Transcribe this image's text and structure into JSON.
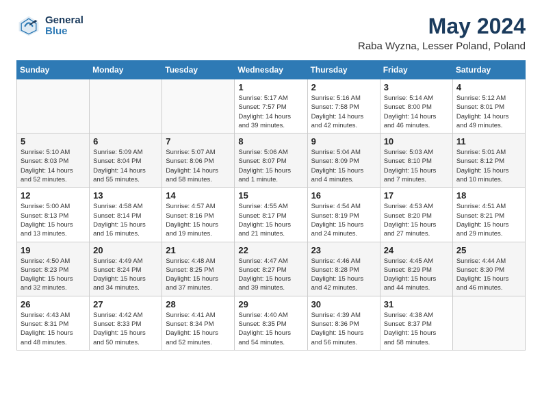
{
  "logo": {
    "general": "General",
    "blue": "Blue"
  },
  "title": "May 2024",
  "location": "Raba Wyzna, Lesser Poland, Poland",
  "weekdays": [
    "Sunday",
    "Monday",
    "Tuesday",
    "Wednesday",
    "Thursday",
    "Friday",
    "Saturday"
  ],
  "weeks": [
    [
      {
        "num": "",
        "info": ""
      },
      {
        "num": "",
        "info": ""
      },
      {
        "num": "",
        "info": ""
      },
      {
        "num": "1",
        "info": "Sunrise: 5:17 AM\nSunset: 7:57 PM\nDaylight: 14 hours\nand 39 minutes."
      },
      {
        "num": "2",
        "info": "Sunrise: 5:16 AM\nSunset: 7:58 PM\nDaylight: 14 hours\nand 42 minutes."
      },
      {
        "num": "3",
        "info": "Sunrise: 5:14 AM\nSunset: 8:00 PM\nDaylight: 14 hours\nand 46 minutes."
      },
      {
        "num": "4",
        "info": "Sunrise: 5:12 AM\nSunset: 8:01 PM\nDaylight: 14 hours\nand 49 minutes."
      }
    ],
    [
      {
        "num": "5",
        "info": "Sunrise: 5:10 AM\nSunset: 8:03 PM\nDaylight: 14 hours\nand 52 minutes."
      },
      {
        "num": "6",
        "info": "Sunrise: 5:09 AM\nSunset: 8:04 PM\nDaylight: 14 hours\nand 55 minutes."
      },
      {
        "num": "7",
        "info": "Sunrise: 5:07 AM\nSunset: 8:06 PM\nDaylight: 14 hours\nand 58 minutes."
      },
      {
        "num": "8",
        "info": "Sunrise: 5:06 AM\nSunset: 8:07 PM\nDaylight: 15 hours\nand 1 minute."
      },
      {
        "num": "9",
        "info": "Sunrise: 5:04 AM\nSunset: 8:09 PM\nDaylight: 15 hours\nand 4 minutes."
      },
      {
        "num": "10",
        "info": "Sunrise: 5:03 AM\nSunset: 8:10 PM\nDaylight: 15 hours\nand 7 minutes."
      },
      {
        "num": "11",
        "info": "Sunrise: 5:01 AM\nSunset: 8:12 PM\nDaylight: 15 hours\nand 10 minutes."
      }
    ],
    [
      {
        "num": "12",
        "info": "Sunrise: 5:00 AM\nSunset: 8:13 PM\nDaylight: 15 hours\nand 13 minutes."
      },
      {
        "num": "13",
        "info": "Sunrise: 4:58 AM\nSunset: 8:14 PM\nDaylight: 15 hours\nand 16 minutes."
      },
      {
        "num": "14",
        "info": "Sunrise: 4:57 AM\nSunset: 8:16 PM\nDaylight: 15 hours\nand 19 minutes."
      },
      {
        "num": "15",
        "info": "Sunrise: 4:55 AM\nSunset: 8:17 PM\nDaylight: 15 hours\nand 21 minutes."
      },
      {
        "num": "16",
        "info": "Sunrise: 4:54 AM\nSunset: 8:19 PM\nDaylight: 15 hours\nand 24 minutes."
      },
      {
        "num": "17",
        "info": "Sunrise: 4:53 AM\nSunset: 8:20 PM\nDaylight: 15 hours\nand 27 minutes."
      },
      {
        "num": "18",
        "info": "Sunrise: 4:51 AM\nSunset: 8:21 PM\nDaylight: 15 hours\nand 29 minutes."
      }
    ],
    [
      {
        "num": "19",
        "info": "Sunrise: 4:50 AM\nSunset: 8:23 PM\nDaylight: 15 hours\nand 32 minutes."
      },
      {
        "num": "20",
        "info": "Sunrise: 4:49 AM\nSunset: 8:24 PM\nDaylight: 15 hours\nand 34 minutes."
      },
      {
        "num": "21",
        "info": "Sunrise: 4:48 AM\nSunset: 8:25 PM\nDaylight: 15 hours\nand 37 minutes."
      },
      {
        "num": "22",
        "info": "Sunrise: 4:47 AM\nSunset: 8:27 PM\nDaylight: 15 hours\nand 39 minutes."
      },
      {
        "num": "23",
        "info": "Sunrise: 4:46 AM\nSunset: 8:28 PM\nDaylight: 15 hours\nand 42 minutes."
      },
      {
        "num": "24",
        "info": "Sunrise: 4:45 AM\nSunset: 8:29 PM\nDaylight: 15 hours\nand 44 minutes."
      },
      {
        "num": "25",
        "info": "Sunrise: 4:44 AM\nSunset: 8:30 PM\nDaylight: 15 hours\nand 46 minutes."
      }
    ],
    [
      {
        "num": "26",
        "info": "Sunrise: 4:43 AM\nSunset: 8:31 PM\nDaylight: 15 hours\nand 48 minutes."
      },
      {
        "num": "27",
        "info": "Sunrise: 4:42 AM\nSunset: 8:33 PM\nDaylight: 15 hours\nand 50 minutes."
      },
      {
        "num": "28",
        "info": "Sunrise: 4:41 AM\nSunset: 8:34 PM\nDaylight: 15 hours\nand 52 minutes."
      },
      {
        "num": "29",
        "info": "Sunrise: 4:40 AM\nSunset: 8:35 PM\nDaylight: 15 hours\nand 54 minutes."
      },
      {
        "num": "30",
        "info": "Sunrise: 4:39 AM\nSunset: 8:36 PM\nDaylight: 15 hours\nand 56 minutes."
      },
      {
        "num": "31",
        "info": "Sunrise: 4:38 AM\nSunset: 8:37 PM\nDaylight: 15 hours\nand 58 minutes."
      },
      {
        "num": "",
        "info": ""
      }
    ]
  ]
}
